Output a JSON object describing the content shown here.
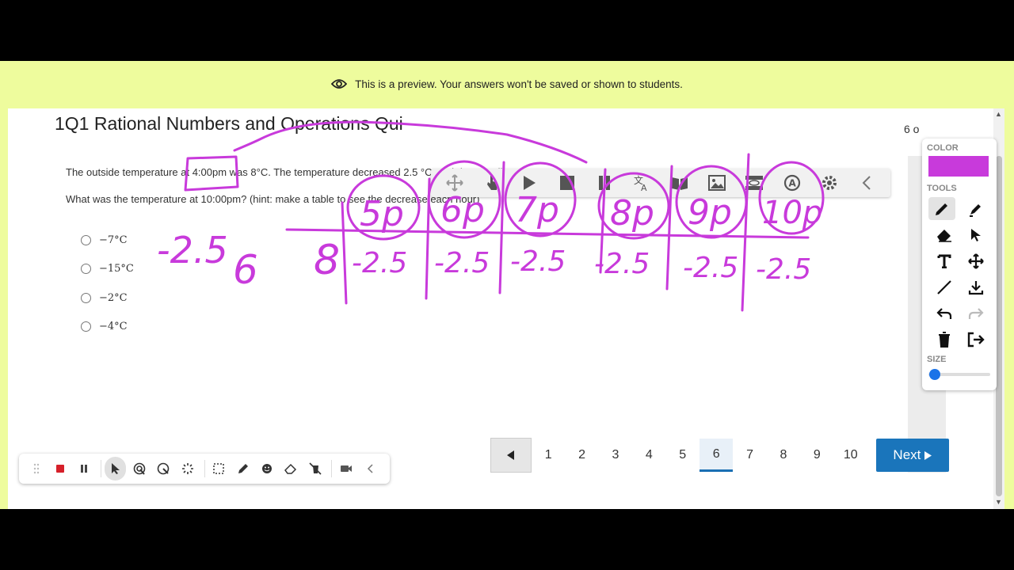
{
  "preview": {
    "text": "This is a preview. Your answers won't be saved or shown to students."
  },
  "quiz": {
    "title": "1Q1 Rational Numbers and Operations Qui",
    "page_count": "6 o",
    "question_line1": "The outside temperature at 4:00pm was 8°C.  The temperature decreased 2.5 °C each hour until 10:00pm.",
    "question_line2": "What was the temperature at 10:00pm? (hint: make a table to see the decrease each hour)",
    "options": [
      "−7°C",
      "−15°C",
      "−2°C",
      "−4°C"
    ]
  },
  "pager": {
    "pages": [
      "1",
      "2",
      "3",
      "4",
      "5",
      "6",
      "7",
      "8",
      "9",
      "10"
    ],
    "current": "6",
    "next_label": "Next"
  },
  "annotation_panel": {
    "color_label": "COLOR",
    "tools_label": "TOOLS",
    "size_label": "SIZE",
    "color": "#c83adb"
  },
  "ink": {
    "color": "#c83adb",
    "left_notes": [
      "-2.5",
      "6",
      "8"
    ],
    "hour_labels": [
      "5p",
      "6p",
      "7p",
      "8p",
      "9p",
      "10p"
    ],
    "decrements": [
      "-2.5",
      "-2.5",
      "-2.5",
      "-2.5",
      "-2.5",
      "-2.5"
    ]
  }
}
